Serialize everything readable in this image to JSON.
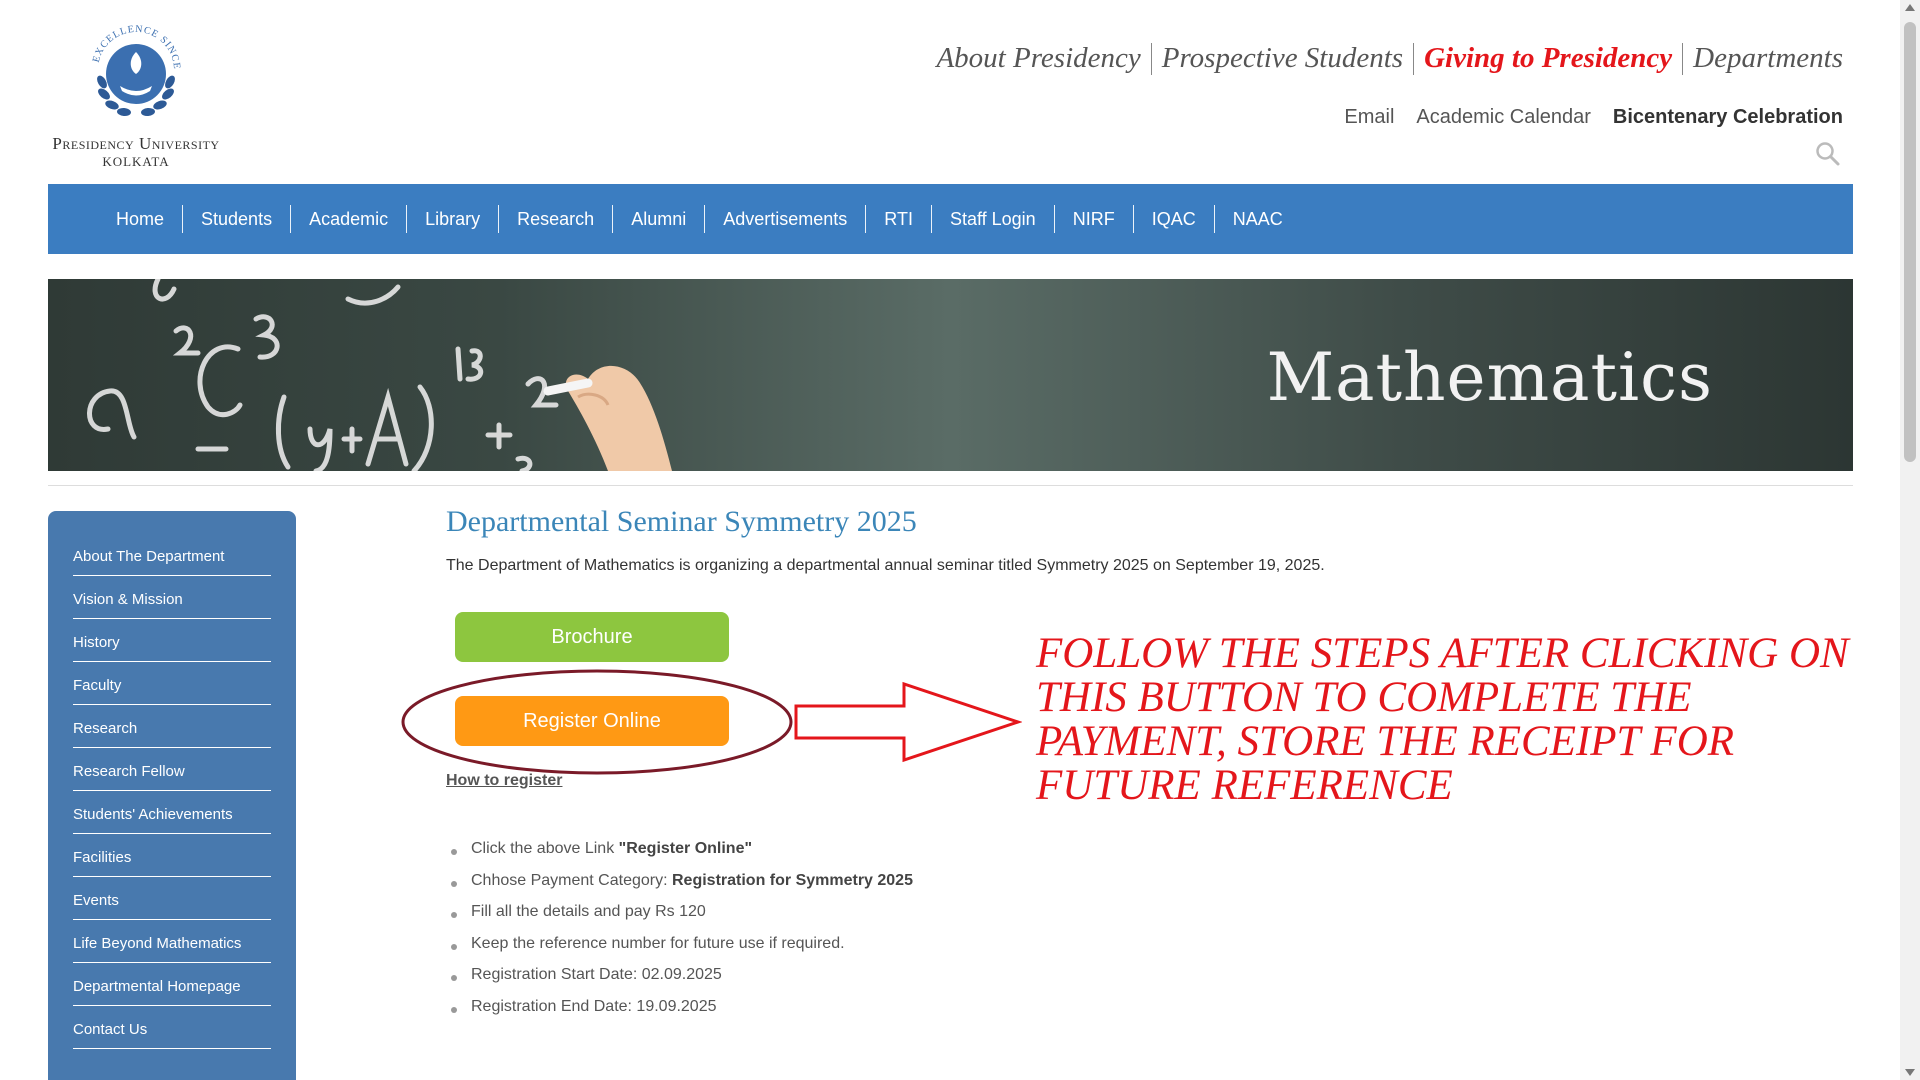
{
  "logo": {
    "seal_text": "EXCELLENCE SINCE 1817",
    "name": "Presidency University",
    "city": "KOLKATA"
  },
  "top_nav": {
    "items": [
      "About Presidency",
      "Prospective Students",
      "Giving to Presidency",
      "Departments"
    ],
    "highlight_color": "#e4161b"
  },
  "sub_nav": {
    "email": "Email",
    "calendar": "Academic Calendar",
    "bicentenary": "Bicentenary Celebration"
  },
  "main_menu": {
    "items": [
      "Home",
      "Students",
      "Academic",
      "Library",
      "Research",
      "Alumni",
      "Advertisements",
      "RTI",
      "Staff Login",
      "NIRF",
      "IQAC",
      "NAAC"
    ],
    "color": "#3b7dc1"
  },
  "banner": {
    "title": "Mathematics"
  },
  "sidebar": {
    "items": [
      "About The Department",
      "Vision & Mission",
      "History",
      "Faculty",
      "Research",
      "Research Fellow",
      "Students' Achievements",
      "Facilities",
      "Events",
      "Life Beyond Mathematics",
      "Departmental Homepage",
      "Contact Us"
    ],
    "color": "#4879ae"
  },
  "main": {
    "heading": "Departmental Seminar Symmetry 2025",
    "intro": "The Department of Mathematics is organizing a departmental annual seminar titled Symmetry 2025 on September 19, 2025.",
    "brochure_label": "Brochure",
    "register_label": "Register Online",
    "how_to": "How to register",
    "steps": [
      {
        "text": "Click the above Link ",
        "bold": "\"Register Online\""
      },
      {
        "text": "Chhose Payment Category: ",
        "bold": "Registration for Symmetry 2025"
      },
      {
        "text": "Fill all the details and pay Rs 120",
        "bold": ""
      },
      {
        "text": "Keep the reference number for future use if required.",
        "bold": ""
      },
      {
        "text": "Registration Start Date: 02.09.2025",
        "bold": ""
      },
      {
        "text": "Registration End Date: 19.09.2025",
        "bold": ""
      }
    ],
    "brochure_color": "#8dc63f",
    "register_color": "#ff9914"
  },
  "annotation": {
    "text": "FOLLOW THE STEPS AFTER CLICKING ON THIS BUTTON TO COMPLETE THE PAYMENT, STORE THE RECEIPT FOR FUTURE REFERENCE",
    "color": "#e4161b"
  }
}
